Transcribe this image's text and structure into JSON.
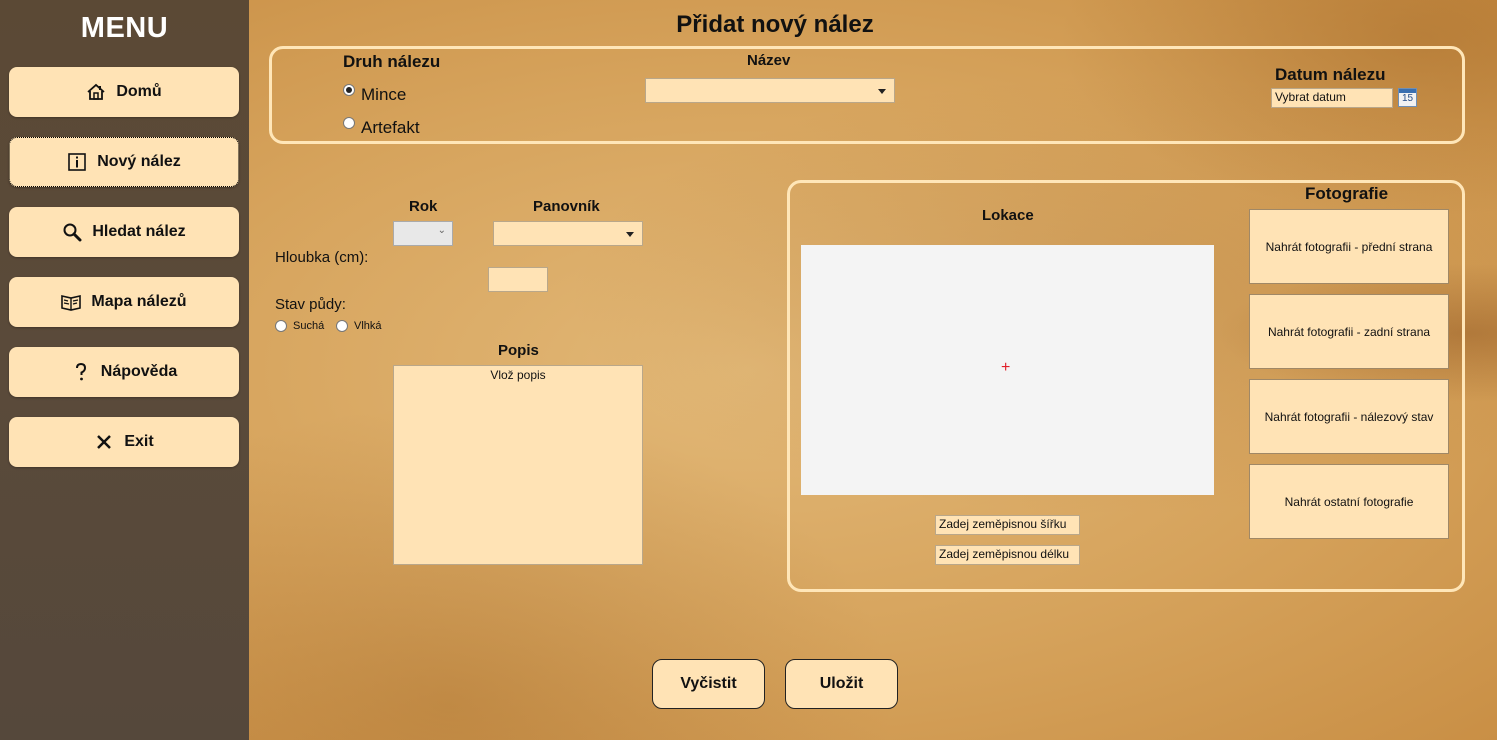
{
  "sidebar": {
    "title": "MENU",
    "items": [
      {
        "label": "Domů",
        "icon": "home-icon"
      },
      {
        "label": "Nový nález",
        "icon": "info-icon"
      },
      {
        "label": "Hledat nález",
        "icon": "search-icon"
      },
      {
        "label": "Mapa nálezů",
        "icon": "map-book-icon"
      },
      {
        "label": "Nápověda",
        "icon": "question-icon"
      },
      {
        "label": "Exit",
        "icon": "close-icon"
      }
    ],
    "active_index": 1
  },
  "page_title": "Přidat nový nález",
  "top": {
    "find_type_label": "Druh nálezu",
    "find_type_options": [
      "Mince",
      "Artefakt"
    ],
    "find_type_selected": "Mince",
    "name_label": "Název",
    "name_value": "",
    "date_label": "Datum nálezu",
    "date_placeholder": "Vybrat datum",
    "calendar_day": "15"
  },
  "details": {
    "year_label": "Rok",
    "ruler_label": "Panovník",
    "depth_label": "Hloubka (cm):",
    "soil_label": "Stav půdy:",
    "soil_options": [
      "Suchá",
      "Vlhká"
    ],
    "description_label": "Popis",
    "description_value": "Vlož popis"
  },
  "location": {
    "label": "Lokace",
    "latitude_placeholder": "Zadej zeměpisnou šířku",
    "longitude_placeholder": "Zadej zeměpisnou délku"
  },
  "photos": {
    "label": "Fotografie",
    "buttons": [
      "Nahrát fotografii - přední strana",
      "Nahrát fotografii - zadní strana",
      "Nahrát fotografii - nálezový stav",
      "Nahrát ostatní fotografie"
    ]
  },
  "actions": {
    "clear_label": "Vyčistit",
    "save_label": "Uložit"
  },
  "colors": {
    "sidebar_bg": "#5a4a3a",
    "button_bg": "#ffe3b5",
    "panel_border": "#ffe6b8",
    "map_bg": "#f4f4f4",
    "crosshair": "#e0202a"
  }
}
